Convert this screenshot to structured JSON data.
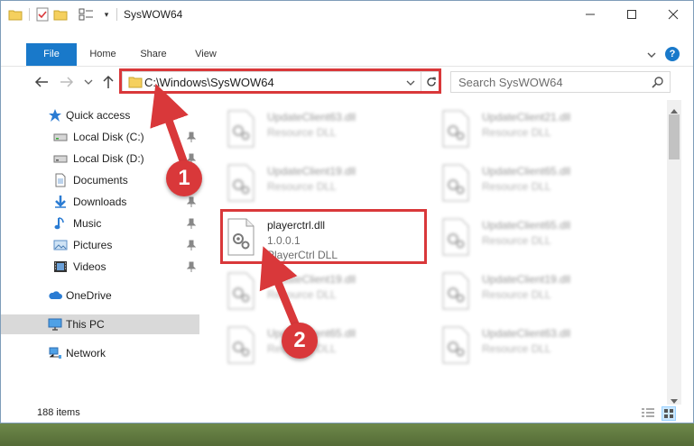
{
  "window": {
    "title": "SysWOW64",
    "quick_access_toolbar_dropdown": "▾"
  },
  "ribbon": {
    "tabs": [
      {
        "label": "File"
      },
      {
        "label": "Home"
      },
      {
        "label": "Share"
      },
      {
        "label": "View"
      }
    ],
    "help_label": "?"
  },
  "address_bar": {
    "path": "C:\\Windows\\SysWOW64"
  },
  "search": {
    "placeholder": "Search SysWOW64"
  },
  "nav_pane": {
    "items": [
      {
        "label": "Quick access",
        "icon": "star-icon"
      },
      {
        "label": "Local Disk (C:)",
        "icon": "drive-icon",
        "pinned": true
      },
      {
        "label": "Local Disk (D:)",
        "icon": "drive-icon",
        "pinned": true
      },
      {
        "label": "Documents",
        "icon": "documents-icon",
        "pinned": true
      },
      {
        "label": "Downloads",
        "icon": "download-icon",
        "pinned": true
      },
      {
        "label": "Music",
        "icon": "music-icon",
        "pinned": true
      },
      {
        "label": "Pictures",
        "icon": "pictures-icon",
        "pinned": true
      },
      {
        "label": "Videos",
        "icon": "videos-icon",
        "pinned": true
      },
      {
        "label": "OneDrive",
        "icon": "cloud-icon"
      },
      {
        "label": "This PC",
        "icon": "computer-icon",
        "selected": true
      },
      {
        "label": "Network",
        "icon": "network-icon"
      }
    ]
  },
  "files": {
    "left_column": [
      {
        "name": "UpdateClient63.dll",
        "desc": "Resource DLL",
        "blurred": true
      },
      {
        "name": "UpdateClient19.dll",
        "desc": "Resource DLL",
        "blurred": true
      },
      {
        "name": "playerctrl.dll",
        "version": "1.0.0.1",
        "desc": "PlayerCtrl DLL",
        "blurred": false
      },
      {
        "name": "UpdateClient19.dll",
        "desc": "Resource DLL",
        "blurred": true
      },
      {
        "name": "UpdateClient65.dll",
        "desc": "Resource DLL",
        "blurred": true
      }
    ],
    "right_column": [
      {
        "name": "UpdateClient21.dll",
        "desc": "Resource DLL",
        "blurred": true
      },
      {
        "name": "UpdateClient65.dll",
        "desc": "Resource DLL",
        "blurred": true
      },
      {
        "name": "UpdateClient65.dll",
        "desc": "Resource DLL",
        "blurred": true
      },
      {
        "name": "UpdateClient19.dll",
        "desc": "Resource DLL",
        "blurred": true
      },
      {
        "name": "UpdateClient63.dll",
        "desc": "Resource DLL",
        "blurred": true
      }
    ]
  },
  "status_bar": {
    "item_count": "188 items"
  },
  "annotations": {
    "step_1": "1",
    "step_2": "2",
    "highlight_color": "#d9383a"
  },
  "colors": {
    "accent": "#1979ca",
    "selection": "#cce8ff"
  }
}
